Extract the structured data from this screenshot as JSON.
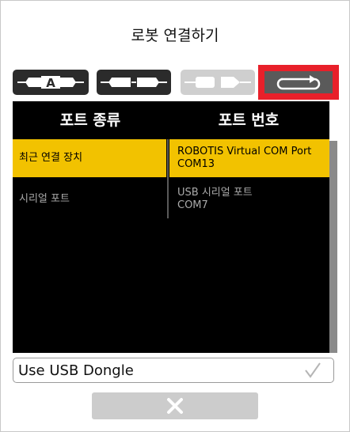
{
  "dialog": {
    "title": "로봇 연결하기"
  },
  "connection_types": [
    {
      "icon": "cable-a-icon",
      "label": "A"
    },
    {
      "icon": "cable-connector-icon"
    },
    {
      "icon": "cable-disabled-icon"
    },
    {
      "icon": "refresh-loop-icon"
    }
  ],
  "table": {
    "headers": {
      "type": "포트 종류",
      "number": "포트 번호"
    },
    "rows": [
      {
        "type": "최근 연결 장치",
        "port_name": "ROBOTIS Virtual COM Port",
        "port_id": "COM13",
        "selected": true
      },
      {
        "type": "시리얼 포트",
        "port_name": "USB 시리얼 포트",
        "port_id": "COM7",
        "selected": false
      }
    ]
  },
  "dongle": {
    "label": "Use USB Dongle",
    "icon": "checkmark-icon"
  },
  "close": {
    "icon": "close-icon"
  },
  "colors": {
    "selected": "#f2c200",
    "highlight": "#e8202a",
    "table_bg": "#000000"
  }
}
